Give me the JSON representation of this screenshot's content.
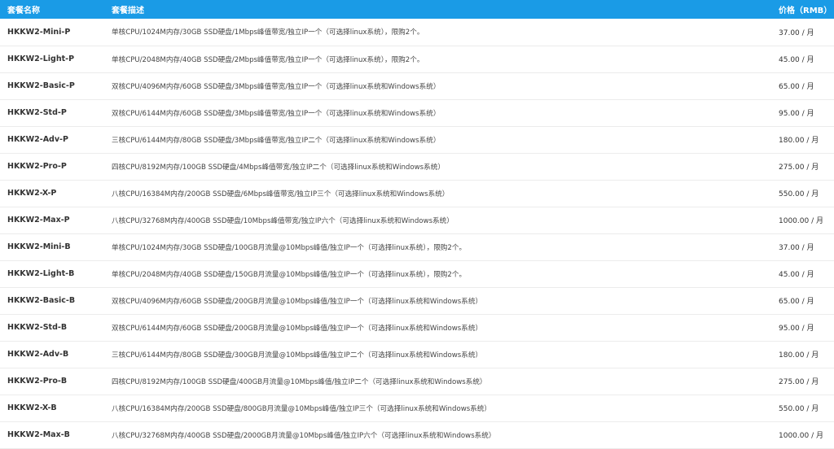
{
  "table": {
    "headers": {
      "name": "套餐名称",
      "description": "套餐描述",
      "price": "价格（RMB）"
    },
    "rows": [
      {
        "name": "HKKW2-Mini-P",
        "description": "单核CPU/1024M内存/30GB SSD硬盘/1Mbps峰值带宽/独立IP一个（可选择linux系统），限购2个。",
        "price": "37.00 / 月"
      },
      {
        "name": "HKKW2-Light-P",
        "description": "单核CPU/2048M内存/40GB SSD硬盘/2Mbps峰值带宽/独立IP一个（可选择linux系统），限购2个。",
        "price": "45.00 / 月"
      },
      {
        "name": "HKKW2-Basic-P",
        "description": "双核CPU/4096M内存/60GB SSD硬盘/3Mbps峰值带宽/独立IP一个（可选择linux系统和Windows系统）",
        "price": "65.00 / 月"
      },
      {
        "name": "HKKW2-Std-P",
        "description": "双核CPU/6144M内存/60GB SSD硬盘/3Mbps峰值带宽/独立IP一个（可选择linux系统和Windows系统）",
        "price": "95.00 / 月"
      },
      {
        "name": "HKKW2-Adv-P",
        "description": "三核CPU/6144M内存/80GB SSD硬盘/3Mbps峰值带宽/独立IP二个（可选择linux系统和Windows系统）",
        "price": "180.00 / 月"
      },
      {
        "name": "HKKW2-Pro-P",
        "description": "四核CPU/8192M内存/100GB SSD硬盘/4Mbps峰值带宽/独立IP二个（可选择linux系统和Windows系统）",
        "price": "275.00 / 月"
      },
      {
        "name": "HKKW2-X-P",
        "description": "八核CPU/16384M内存/200GB SSD硬盘/6Mbps峰值带宽/独立IP三个（可选择linux系统和Windows系统）",
        "price": "550.00 / 月"
      },
      {
        "name": "HKKW2-Max-P",
        "description": "八核CPU/32768M内存/400GB SSD硬盘/10Mbps峰值带宽/独立IP六个（可选择linux系统和Windows系统）",
        "price": "1000.00 / 月"
      },
      {
        "name": "HKKW2-Mini-B",
        "description": "单核CPU/1024M内存/30GB SSD硬盘/100GB月流量@10Mbps峰值/独立IP一个（可选择linux系统），限购2个。",
        "price": "37.00 / 月"
      },
      {
        "name": "HKKW2-Light-B",
        "description": "单核CPU/2048M内存/40GB SSD硬盘/150GB月流量@10Mbps峰值/独立IP一个（可选择linux系统），限购2个。",
        "price": "45.00 / 月"
      },
      {
        "name": "HKKW2-Basic-B",
        "description": "双核CPU/4096M内存/60GB SSD硬盘/200GB月流量@10Mbps峰值/独立IP一个（可选择linux系统和Windows系统）",
        "price": "65.00 / 月"
      },
      {
        "name": "HKKW2-Std-B",
        "description": "双核CPU/6144M内存/60GB SSD硬盘/200GB月流量@10Mbps峰值/独立IP一个（可选择linux系统和Windows系统）",
        "price": "95.00 / 月"
      },
      {
        "name": "HKKW2-Adv-B",
        "description": "三核CPU/6144M内存/80GB SSD硬盘/300GB月流量@10Mbps峰值/独立IP二个（可选择linux系统和Windows系统）",
        "price": "180.00 / 月"
      },
      {
        "name": "HKKW2-Pro-B",
        "description": "四核CPU/8192M内存/100GB SSD硬盘/400GB月流量@10Mbps峰值/独立IP二个（可选择linux系统和Windows系统）",
        "price": "275.00 / 月"
      },
      {
        "name": "HKKW2-X-B",
        "description": "八核CPU/16384M内存/200GB SSD硬盘/800GB月流量@10Mbps峰值/独立IP三个（可选择linux系统和Windows系统）",
        "price": "550.00 / 月"
      },
      {
        "name": "HKKW2-Max-B",
        "description": "八核CPU/32768M内存/400GB SSD硬盘/2000GB月流量@10Mbps峰值/独立IP六个（可选择linux系统和Windows系统）",
        "price": "1000.00 / 月"
      }
    ]
  },
  "colors": {
    "header_bg": "#1a9be6",
    "header_text": "#ffffff",
    "row_border": "#ececec",
    "text": "#333333"
  }
}
